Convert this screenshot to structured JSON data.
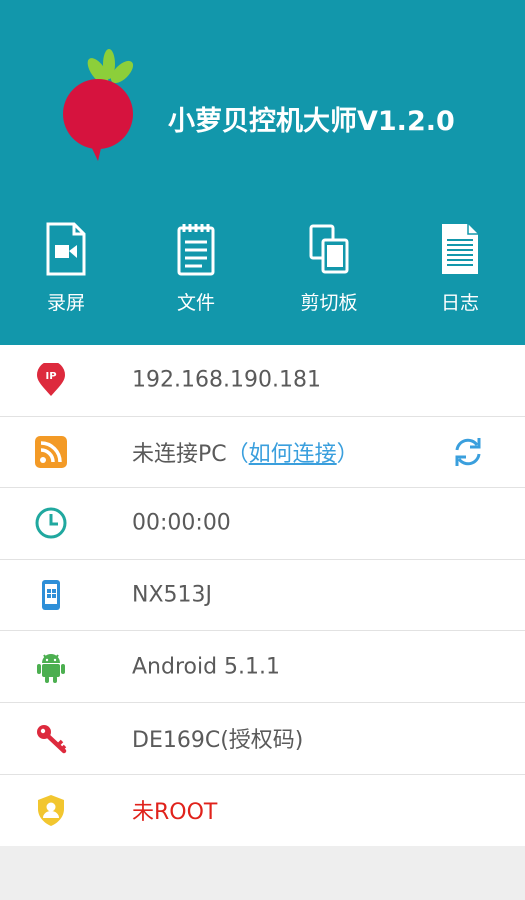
{
  "app": {
    "title": "小萝贝控机大师V1.2.0"
  },
  "toolbar": [
    {
      "label": "录屏",
      "icon": "screen-record-icon"
    },
    {
      "label": "文件",
      "icon": "file-icon"
    },
    {
      "label": "剪切板",
      "icon": "clipboard-icon"
    },
    {
      "label": "日志",
      "icon": "log-icon"
    }
  ],
  "info": {
    "ip": "192.168.190.181",
    "connection": {
      "status": "未连接PC",
      "paren_open": "（",
      "link": "如何连接",
      "paren_close": "）"
    },
    "timer": "00:00:00",
    "model": "NX513J",
    "android": "Android  5.1.1",
    "license": "DE169C(授权码)",
    "root": "未ROOT"
  },
  "colors": {
    "header": "#1297ab",
    "accent_blue": "#3a9fdd",
    "warning_red": "#e0221b"
  }
}
